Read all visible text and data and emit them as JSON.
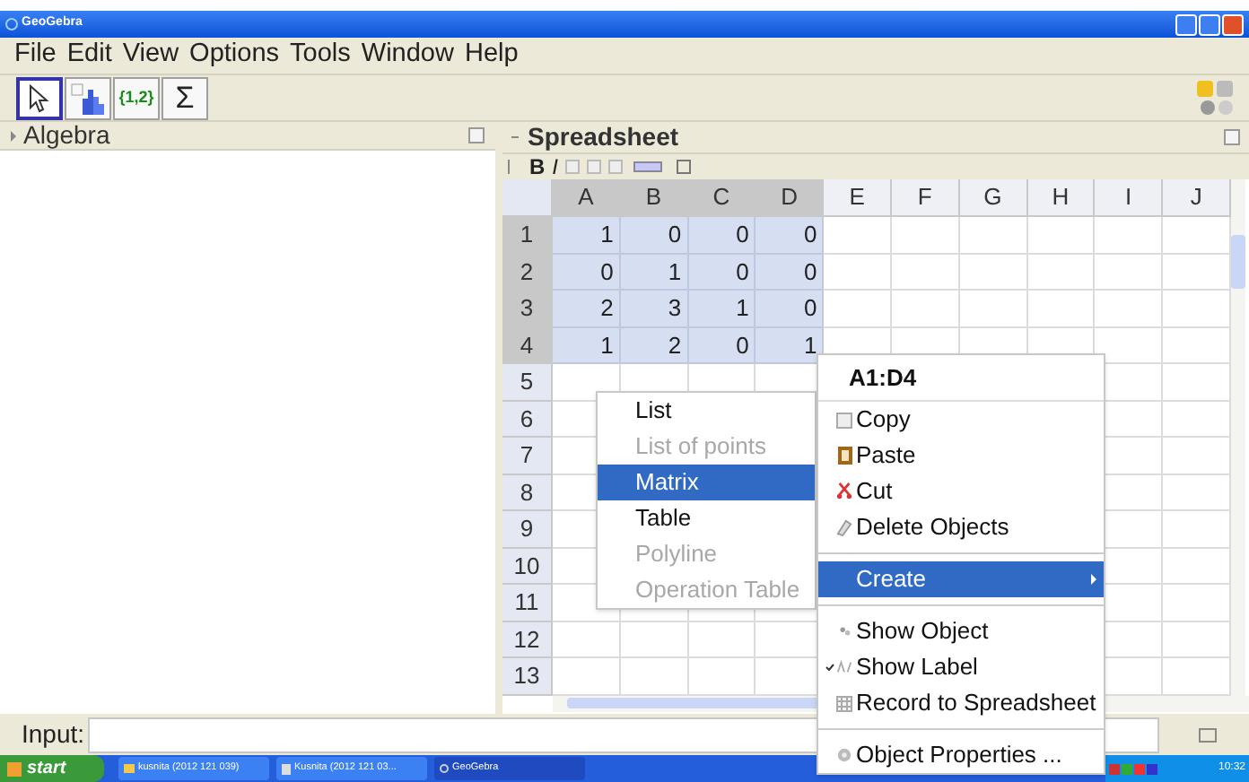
{
  "window": {
    "title": "GeoGebra"
  },
  "menu": [
    "File",
    "Edit",
    "View",
    "Options",
    "Tools",
    "Window",
    "Help"
  ],
  "toolbar": [
    {
      "kind": "cursor",
      "selected": true
    },
    {
      "kind": "chart",
      "selected": false
    },
    {
      "kind": "text",
      "label": "{1,2}",
      "selected": false
    },
    {
      "kind": "text",
      "label": "Σ",
      "selected": false
    }
  ],
  "algebra": {
    "title": "Algebra"
  },
  "spreadsheet": {
    "title": "Spreadsheet",
    "format": [
      "B",
      "I"
    ],
    "columns": [
      {
        "label": "A",
        "selected": true
      },
      {
        "label": "B",
        "selected": true
      },
      {
        "label": "C",
        "selected": true
      },
      {
        "label": "D",
        "selected": true
      },
      {
        "label": "E",
        "selected": false
      },
      {
        "label": "F",
        "selected": false
      },
      {
        "label": "G",
        "selected": false
      },
      {
        "label": "H",
        "selected": false
      },
      {
        "label": "I",
        "selected": false
      },
      {
        "label": "J",
        "selected": false
      }
    ],
    "rows": [
      {
        "label": "1",
        "selected": true,
        "cells": [
          "1",
          "0",
          "0",
          "0"
        ]
      },
      {
        "label": "2",
        "selected": true,
        "cells": [
          "0",
          "1",
          "0",
          "0"
        ]
      },
      {
        "label": "3",
        "selected": true,
        "cells": [
          "2",
          "3",
          "1",
          "0"
        ]
      },
      {
        "label": "4",
        "selected": true,
        "cells": [
          "1",
          "2",
          "0",
          "1"
        ]
      },
      {
        "label": "5",
        "selected": false,
        "cells": []
      },
      {
        "label": "6",
        "selected": false,
        "cells": []
      },
      {
        "label": "7",
        "selected": false,
        "cells": []
      },
      {
        "label": "8",
        "selected": false,
        "cells": []
      },
      {
        "label": "9",
        "selected": false,
        "cells": []
      },
      {
        "label": "10",
        "selected": false,
        "cells": []
      },
      {
        "label": "11",
        "selected": false,
        "cells": []
      },
      {
        "label": "12",
        "selected": false,
        "cells": []
      },
      {
        "label": "13",
        "selected": false,
        "cells": []
      }
    ]
  },
  "context_menu": {
    "title": "A1:D4",
    "items": [
      {
        "kind": "item",
        "label": "Copy",
        "selected": false,
        "checked": false
      },
      {
        "kind": "item",
        "label": "Paste",
        "selected": false,
        "checked": false
      },
      {
        "kind": "item",
        "label": "Cut",
        "selected": false,
        "checked": false
      },
      {
        "kind": "item",
        "label": "Delete Objects",
        "selected": false,
        "checked": false
      },
      {
        "kind": "separator"
      },
      {
        "kind": "submenu",
        "label": "Create",
        "selected": true
      },
      {
        "kind": "separator"
      },
      {
        "kind": "item",
        "label": "Show Object",
        "selected": false,
        "checked": false
      },
      {
        "kind": "item",
        "label": "Show Label",
        "selected": false,
        "checked": true
      },
      {
        "kind": "item",
        "label": "Record to Spreadsheet",
        "selected": false,
        "checked": false
      },
      {
        "kind": "separator"
      },
      {
        "kind": "item",
        "label": "Object Properties ...",
        "selected": false,
        "checked": false
      }
    ]
  },
  "submenu": [
    {
      "label": "List",
      "selected": false,
      "disabled": false
    },
    {
      "label": "List of points",
      "selected": false,
      "disabled": true
    },
    {
      "label": "Matrix",
      "selected": true,
      "disabled": false
    },
    {
      "label": "Table",
      "selected": false,
      "disabled": false
    },
    {
      "label": "Polyline",
      "selected": false,
      "disabled": true
    },
    {
      "label": "Operation Table",
      "selected": false,
      "disabled": true
    }
  ],
  "input_bar": {
    "label": "Input:"
  },
  "taskbar": {
    "start": "start",
    "tasks": [
      {
        "kind": "folder",
        "label": "kusnita (2012 121 039)",
        "selected": false
      },
      {
        "kind": "image",
        "label": "Kusnita (2012 121 03...",
        "selected": false
      },
      {
        "kind": "app",
        "label": "GeoGebra",
        "selected": true
      }
    ],
    "clock": "10:32"
  }
}
